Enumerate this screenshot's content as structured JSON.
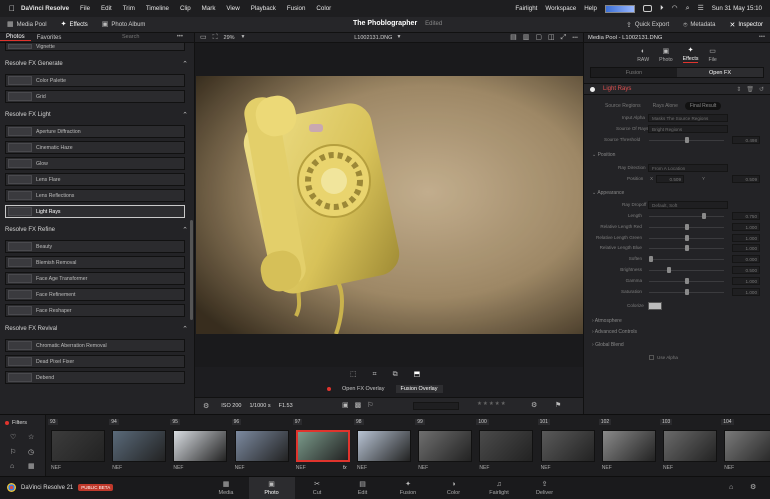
{
  "menubar": {
    "apple_icon": "apple-logo",
    "app_name": "DaVinci Resolve",
    "items": [
      "File",
      "Edit",
      "Trim",
      "Timeline",
      "Clip",
      "Mark",
      "View",
      "Playback",
      "Fusion",
      "Color"
    ],
    "right_items": [
      "Fairlight",
      "Workspace",
      "Help"
    ],
    "datetime": "Sun 31 May  15:10"
  },
  "toolbar": {
    "media_pool": "Media Pool",
    "effects": "Effects",
    "photo_album": "Photo Album",
    "project_title": "The Phoblographer",
    "project_status": "Edited",
    "quick_export": "Quick Export",
    "metadata": "Metadata",
    "inspector": "Inspector"
  },
  "left": {
    "tabs": [
      "Photos",
      "Favorites"
    ],
    "search_placeholder": "Search",
    "top_item": "Vignette",
    "sections": [
      {
        "title": "Resolve FX Generate",
        "items": [
          "Color Palette",
          "Grid"
        ]
      },
      {
        "title": "Resolve FX Light",
        "items": [
          "Aperture Diffraction",
          "Cinematic Haze",
          "Glow",
          "Lens Flare",
          "Lens Reflections",
          "Light Rays"
        ]
      },
      {
        "title": "Resolve FX Refine",
        "items": [
          "Beauty",
          "Blemish Removal",
          "Face Age Transformer",
          "Face Refinement",
          "Face Reshaper"
        ]
      },
      {
        "title": "Resolve FX Revival",
        "items": [
          "Chromatic Aberration Removal",
          "Dead Pixel Fixer",
          "Debend"
        ]
      }
    ],
    "selected_item": "Light Rays"
  },
  "viewer": {
    "zoom": "29%",
    "filename": "L1002131.DNG",
    "overlay_tabs": [
      "Open FX Overlay",
      "Fusion Overlay"
    ],
    "iso": "ISO 200",
    "shutter": "1/1000 s",
    "aperture": "F1.53"
  },
  "inspector": {
    "title": "Media Pool - L1002131.DNG",
    "tabs": [
      "RAW",
      "Photo",
      "Effects",
      "File"
    ],
    "active_tab": "Effects",
    "sub_tabs": [
      "Fusion",
      "Open FX"
    ],
    "effect_name": "Light Rays",
    "mode_buttons": [
      "Source Regions",
      "Rays Alone",
      "Final Result"
    ],
    "input_alpha_label": "Input Alpha",
    "input_alpha_value": "Masks The Source Regions",
    "source_of_rays_label": "Source Of Rays",
    "source_of_rays_value": "Bright Regions",
    "source_threshold_label": "Source Threshold",
    "source_threshold_value": "0.498",
    "position_group": "Position",
    "ray_direction_label": "Ray Direction",
    "ray_direction_value": "From A Location",
    "position_label": "Position",
    "position_x_label": "X",
    "position_x": "0.509",
    "position_y_label": "Y",
    "position_y": "0.509",
    "appearance_group": "Appearance",
    "ray_dropoff_label": "Ray Dropoff",
    "ray_dropoff_value": "Default, Soft",
    "sliders": [
      {
        "label": "Length",
        "value": "0.750",
        "pos": 0.75
      },
      {
        "label": "Relative Length Red",
        "value": "1.000",
        "pos": 0.5
      },
      {
        "label": "Relative Length Green",
        "value": "1.000",
        "pos": 0.5
      },
      {
        "label": "Relative Length Blue",
        "value": "1.000",
        "pos": 0.5
      },
      {
        "label": "Soften",
        "value": "0.000",
        "pos": 0.0
      },
      {
        "label": "Brightness",
        "value": "0.500",
        "pos": 0.25
      },
      {
        "label": "Gamma",
        "value": "1.000",
        "pos": 0.5
      },
      {
        "label": "Saturation",
        "value": "1.000",
        "pos": 0.5
      }
    ],
    "colorize_label": "Colorize",
    "groups": [
      "Atmosphere",
      "Advanced Controls",
      "Global Blend"
    ],
    "use_alpha": "Use Alpha"
  },
  "strip": {
    "filters_label": "Filters",
    "thumbs": [
      {
        "num": "93",
        "fmt": "NEF",
        "color": "#3c3c3c"
      },
      {
        "num": "94",
        "fmt": "NEF",
        "color": "#5a6a7a"
      },
      {
        "num": "95",
        "fmt": "NEF",
        "color": "#d9dde2"
      },
      {
        "num": "96",
        "fmt": "NEF",
        "color": "#7c8aa0"
      },
      {
        "num": "97",
        "fmt": "NEF",
        "color": "#7a9a8a",
        "selected": true
      },
      {
        "num": "98",
        "fmt": "NEF",
        "color": "#b8c4d4"
      },
      {
        "num": "99",
        "fmt": "NEF",
        "color": "#6f6f6f"
      },
      {
        "num": "100",
        "fmt": "NEF",
        "color": "#4b4b4b"
      },
      {
        "num": "101",
        "fmt": "NEF",
        "color": "#5a5a5a"
      },
      {
        "num": "102",
        "fmt": "NEF",
        "color": "#8a8a8a"
      },
      {
        "num": "103",
        "fmt": "NEF",
        "color": "#6a6a6a"
      },
      {
        "num": "104",
        "fmt": "NEF",
        "color": "#7a7a7a"
      }
    ],
    "fx_mark": "fx"
  },
  "bottom": {
    "app_label": "DaVinci Resolve 21",
    "beta_label": "PUBLIC BETA",
    "pages": [
      "Media",
      "Photo",
      "Cut",
      "Edit",
      "Fusion",
      "Color",
      "Fairlight",
      "Deliver"
    ],
    "active_page": "Photo"
  },
  "colors": {
    "accent_red": "#e0342d",
    "panel": "#232326"
  }
}
